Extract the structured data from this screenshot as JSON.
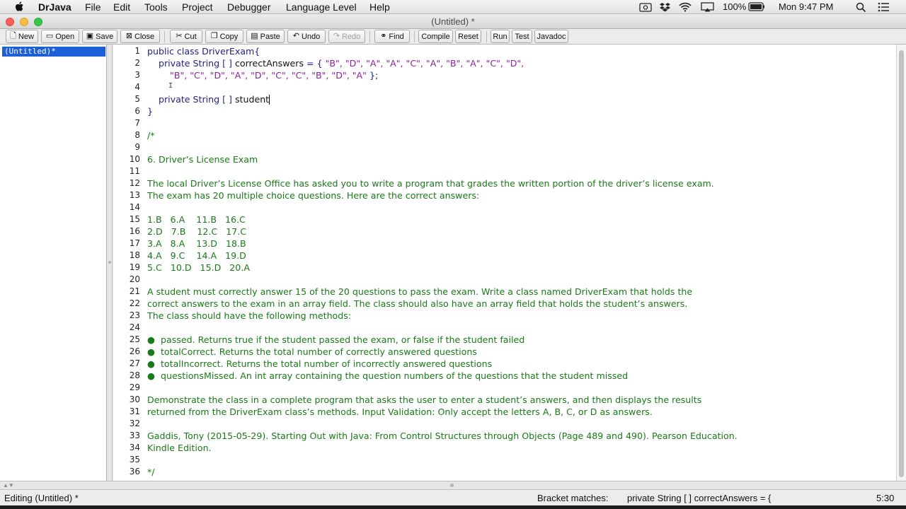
{
  "menubar": {
    "app_name": "DrJava",
    "items": [
      "File",
      "Edit",
      "Tools",
      "Project",
      "Debugger",
      "Language Level",
      "Help"
    ],
    "battery": "100%",
    "clock": "Mon 9:47 PM"
  },
  "window": {
    "title": "(Untitled) *"
  },
  "toolbar": {
    "new": "New",
    "open": "Open",
    "save": "Save",
    "close": "Close",
    "cut": "Cut",
    "copy": "Copy",
    "paste": "Paste",
    "undo": "Undo",
    "redo": "Redo",
    "find": "Find",
    "compile": "Compile",
    "reset": "Reset",
    "run": "Run",
    "test": "Test",
    "javadoc": "Javadoc"
  },
  "documents": [
    "(Untitled)*"
  ],
  "editor": {
    "line_numbers": [
      "1",
      "2",
      "3",
      "4",
      "5",
      "6",
      "7",
      "8",
      "9",
      "10",
      "11",
      "12",
      "13",
      "14",
      "15",
      "16",
      "17",
      "18",
      "19",
      "20",
      "21",
      "22",
      "23",
      "24",
      "25",
      "26",
      "27",
      "28",
      "29",
      "30",
      "31",
      "32",
      "33",
      "34",
      "35",
      "36"
    ],
    "lines": [
      {
        "text": "public class DriverExam{",
        "kind": "code"
      },
      {
        "segments": [
          {
            "text": "    private String [ ] ",
            "kind": "code"
          },
          {
            "text": "correctAnswers",
            "kind": "id"
          },
          {
            "text": " = { ",
            "kind": "code"
          },
          {
            "text": "\"B\", \"D\", \"A\", \"A\", \"C\", \"A\", \"B\", \"A\", \"C\", \"D\",",
            "kind": "str"
          }
        ]
      },
      {
        "segments": [
          {
            "text": "        ",
            "kind": "code"
          },
          {
            "text": "\"B\", \"C\", \"D\", \"A\", \"D\", \"C\", \"C\", \"B\", \"D\", \"A\"",
            "kind": "str"
          },
          {
            "text": " };",
            "kind": "code"
          }
        ]
      },
      {
        "text": "",
        "kind": "code"
      },
      {
        "segments": [
          {
            "text": "    private String [ ] ",
            "kind": "code"
          },
          {
            "text": "student",
            "kind": "id"
          }
        ]
      },
      {
        "text": "}",
        "kind": "code"
      },
      {
        "text": "",
        "kind": "code"
      },
      {
        "text": "/*",
        "kind": "com"
      },
      {
        "text": "",
        "kind": "com"
      },
      {
        "text": "6. Driver’s License Exam",
        "kind": "com"
      },
      {
        "text": "",
        "kind": "com"
      },
      {
        "text": "The local Driver’s License Office has asked you to write a program that grades the written portion of the driver’s license exam.",
        "kind": "com"
      },
      {
        "text": "The exam has 20 multiple choice questions. Here are the correct answers:",
        "kind": "com"
      },
      {
        "text": "",
        "kind": "com"
      },
      {
        "text": "1.B   6.A    11.B   16.C",
        "kind": "com"
      },
      {
        "text": "2.D   7.B    12.C   17.C",
        "kind": "com"
      },
      {
        "text": "3.A   8.A    13.D   18.B",
        "kind": "com"
      },
      {
        "text": "4.A   9.C    14.A   19.D",
        "kind": "com"
      },
      {
        "text": "5.C   10.D   15.D   20.A",
        "kind": "com"
      },
      {
        "text": "",
        "kind": "com"
      },
      {
        "text": "A student must correctly answer 15 of the 20 questions to pass the exam. Write a class named DriverExam that holds the",
        "kind": "com"
      },
      {
        "text": "correct answers to the exam in an array field. The class should also have an array field that holds the student’s answers.",
        "kind": "com"
      },
      {
        "text": "The class should have the following methods:",
        "kind": "com"
      },
      {
        "text": "",
        "kind": "com"
      },
      {
        "text": "●  passed. Returns true if the student passed the exam, or false if the student failed",
        "kind": "com"
      },
      {
        "text": "●  totalCorrect. Returns the total number of correctly answered questions",
        "kind": "com"
      },
      {
        "text": "●  totalIncorrect. Returns the total number of incorrectly answered questions",
        "kind": "com"
      },
      {
        "text": "●  questionsMissed. An int array containing the question numbers of the questions that the student missed",
        "kind": "com"
      },
      {
        "text": "",
        "kind": "com"
      },
      {
        "text": "Demonstrate the class in a complete program that asks the user to enter a student’s answers, and then displays the results",
        "kind": "com"
      },
      {
        "text": "returned from the DriverExam class’s methods. Input Validation: Only accept the letters A, B, C, or D as answers.",
        "kind": "com"
      },
      {
        "text": "",
        "kind": "com"
      },
      {
        "text": "Gaddis, Tony (2015-05-29). Starting Out with Java: From Control Structures through Objects (Page 489 and 490). Pearson Education.",
        "kind": "com"
      },
      {
        "text": "Kindle Edition.",
        "kind": "com"
      },
      {
        "text": "",
        "kind": "com"
      },
      {
        "text": "*/",
        "kind": "com"
      }
    ]
  },
  "statusbar": {
    "mode": "Editing (Untitled) *",
    "bracket_label": "Bracket matches:",
    "bracket_text": "private String [ ] correctAnswers = {",
    "cursor": "5:30"
  },
  "colors": {
    "code": "#1f1f8c",
    "string": "#8a1fa0",
    "comment": "#197a17",
    "selection": "#1c5fd8"
  }
}
